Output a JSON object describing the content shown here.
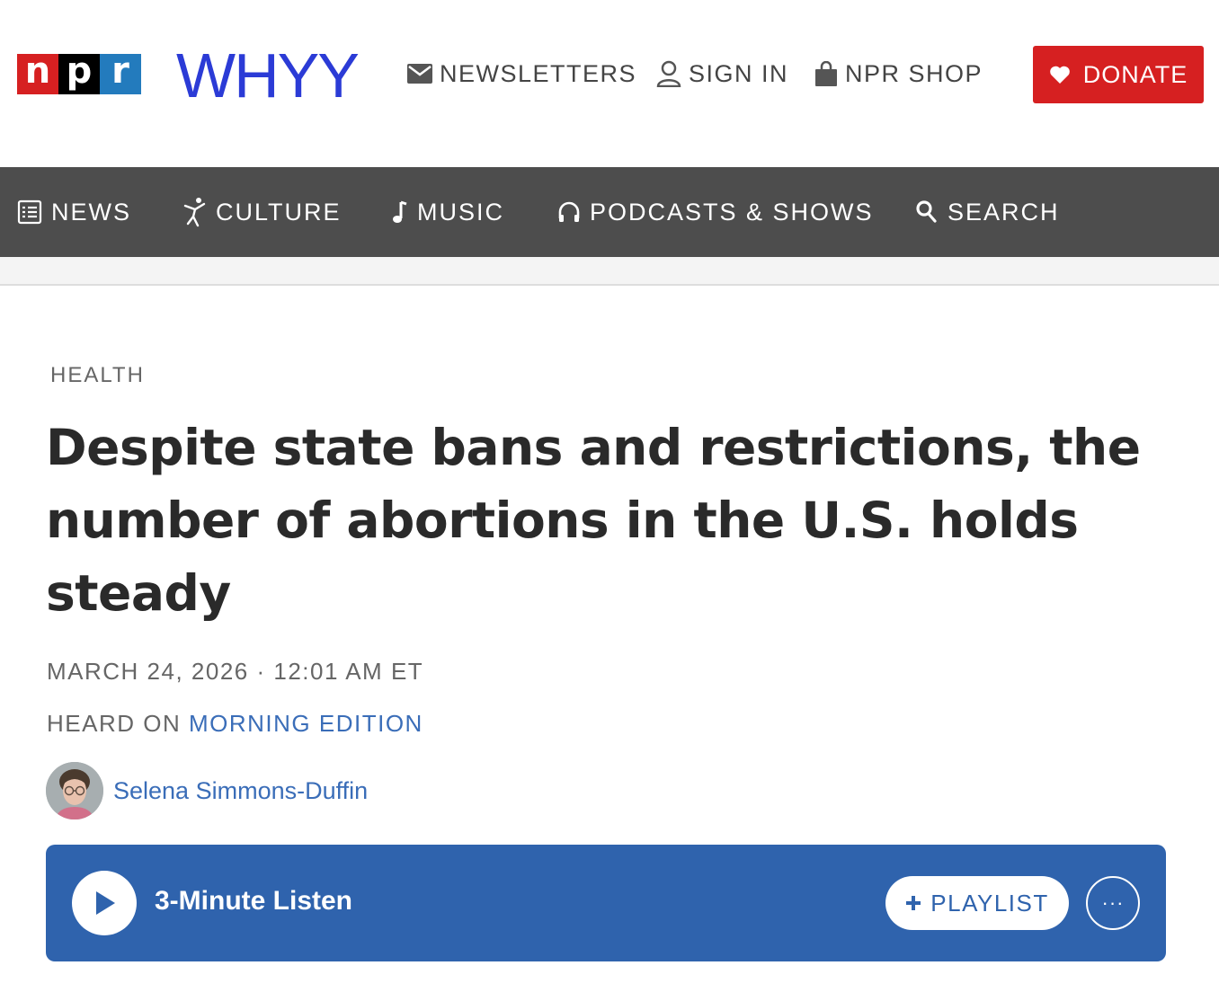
{
  "header": {
    "npr_logo": [
      "n",
      "p",
      "r"
    ],
    "station_logo": "WHYY",
    "utility_links": {
      "newsletters": "NEWSLETTERS",
      "sign_in": "SIGN IN",
      "shop": "NPR SHOP"
    },
    "donate_label": "DONATE",
    "brand_colors": {
      "npr_red": "#d62021",
      "npr_black": "#000000",
      "npr_blue": "#237bbd",
      "station_blue": "#2b3bd6"
    }
  },
  "nav": {
    "items": [
      {
        "label": "NEWS",
        "icon": "news-icon"
      },
      {
        "label": "CULTURE",
        "icon": "culture-icon"
      },
      {
        "label": "MUSIC",
        "icon": "music-note-icon"
      },
      {
        "label": "PODCASTS & SHOWS",
        "icon": "headphones-icon"
      },
      {
        "label": "SEARCH",
        "icon": "search-icon"
      }
    ],
    "background": "#4d4d4d"
  },
  "article": {
    "section": "HEALTH",
    "headline": "Despite state bans and restrictions, the number of abortions in the U.S. holds steady",
    "dateline": "MARCH 24, 2026 · 12:01 AM ET",
    "heard_on_prefix": "HEARD ON",
    "heard_on_show": "MORNING EDITION",
    "author": "Selena Simmons-Duffin"
  },
  "audio_player": {
    "title": "3-Minute Listen",
    "playlist_label": "PLAYLIST",
    "more_label": "···",
    "background": "#2f63ad"
  }
}
